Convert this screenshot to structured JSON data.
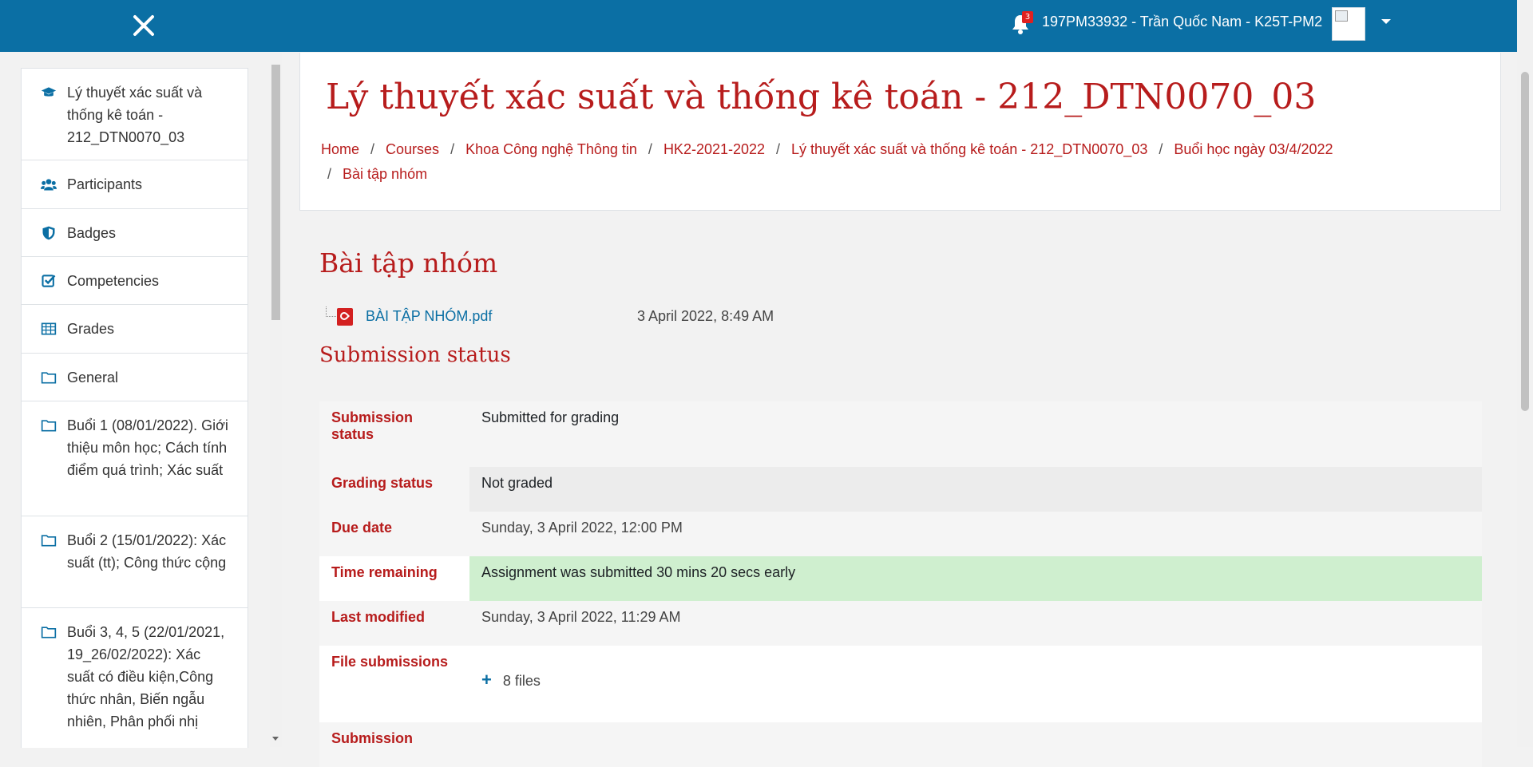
{
  "topbar": {
    "notification_count": "3",
    "user_name": "197PM33932 - Trần Quốc Nam - K25T-PM2"
  },
  "drawer": {
    "items": [
      {
        "label": "Lý thuyết xác suất và thống kê toán - 212_DTN0070_03",
        "icon": "graduation-cap-icon"
      },
      {
        "label": "Participants",
        "icon": "users-icon"
      },
      {
        "label": "Badges",
        "icon": "shield-icon"
      },
      {
        "label": "Competencies",
        "icon": "checkbox-icon"
      },
      {
        "label": "Grades",
        "icon": "table-icon"
      },
      {
        "label": "General",
        "icon": "folder-icon"
      },
      {
        "label": "Buổi 1 (08/01/2022). Giới thiệu môn học; Cách tính điểm quá trình; Xác suất",
        "icon": "folder-icon"
      },
      {
        "label": "Buổi 2 (15/01/2022): Xác suất (tt); Công thức cộng",
        "icon": "folder-icon"
      },
      {
        "label": "Buổi 3, 4, 5 (22/01/2021, 19_26/02/2022): Xác suất có điều kiện,Công thức nhân, Biến ngẫu nhiên, Phân phối nhị",
        "icon": "folder-icon"
      }
    ]
  },
  "header": {
    "title": "Lý thuyết xác suất và thống kê toán - 212_DTN0070_03",
    "breadcrumbs": [
      "Home",
      "Courses",
      "Khoa Công nghệ Thông tin",
      "HK2-2021-2022",
      "Lý thuyết xác suất và thống kê toán - 212_DTN0070_03",
      "Buổi học ngày 03/4/2022",
      "Bài tập nhóm"
    ]
  },
  "activity": {
    "title": "Bài tập nhóm",
    "file_name": "BÀI TẬP NHÓM.pdf",
    "file_date": "3 April 2022, 8:49 AM"
  },
  "submission": {
    "section_title": "Submission status",
    "rows": [
      {
        "label": "Submission status",
        "value": "Submitted for grading"
      },
      {
        "label": "Grading status",
        "value": "Not graded"
      },
      {
        "label": "Due date",
        "value": "Sunday, 3 April 2022, 12:00 PM"
      },
      {
        "label": "Time remaining",
        "value": "Assignment was submitted 30 mins 20 secs early"
      },
      {
        "label": "Last modified",
        "value": "Sunday, 3 April 2022, 11:29 AM"
      },
      {
        "label": "File submissions",
        "value": "8 files"
      },
      {
        "label": "Submission"
      }
    ]
  },
  "colors": {
    "topbar": "#0b6fa4",
    "accent_red": "#b71c1c",
    "link_blue": "#0b6fa4",
    "success_green": "#cfefcf"
  }
}
